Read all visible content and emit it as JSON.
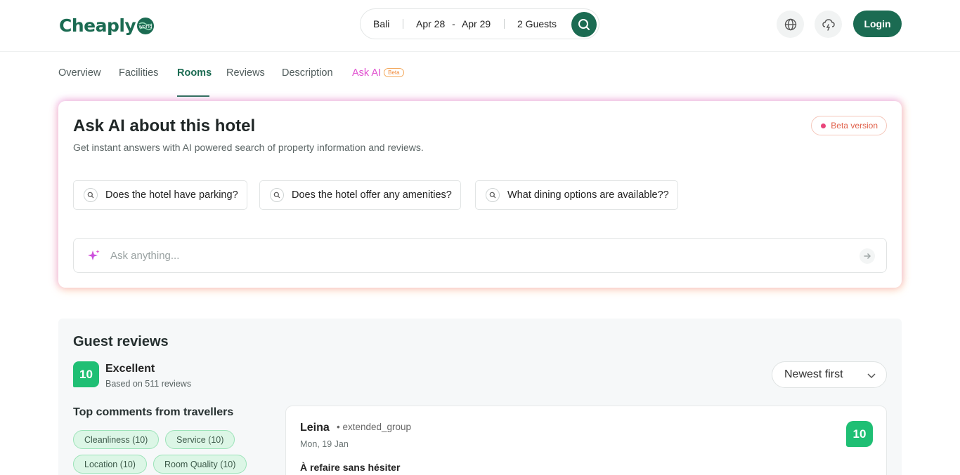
{
  "header": {
    "logo_main": "Cheaply",
    "logo_sub": "world",
    "search": {
      "location": "Bali",
      "date_from": "Apr 28",
      "date_to": "Apr 29",
      "date_sep": "-",
      "guests": "2 Guests"
    },
    "icons": [
      "globe-icon",
      "weather-icon",
      "search-icon"
    ],
    "login_label": "Login"
  },
  "tabs": [
    {
      "label": "Overview"
    },
    {
      "label": "Facilities"
    },
    {
      "label": "Rooms",
      "active": true
    },
    {
      "label": "Reviews"
    },
    {
      "label": "Description"
    },
    {
      "label": "Ask AI",
      "badge": "Beta"
    }
  ],
  "ask_ai": {
    "title": "Ask AI about this hotel",
    "subtitle": "Get instant answers with AI powered search of property information and reviews.",
    "beta_badge": "Beta version",
    "suggestions": [
      "Does the hotel have parking?",
      "Does the hotel offer any amenities?",
      "What dining options are available??"
    ],
    "input_placeholder": "Ask anything...",
    "accent_colors": [
      "#e04fcf",
      "#f08a3a"
    ]
  },
  "reviews": {
    "title": "Guest reviews",
    "score": "10",
    "score_label": "Excellent",
    "based_on": "Based on 511 reviews",
    "sort_selected": "Newest first",
    "top_comments_title": "Top comments from travellers",
    "tags": [
      "Cleanliness (10)",
      "Service (10)",
      "Location (10)",
      "Room Quality (10)"
    ],
    "items": [
      {
        "name": "Leina",
        "group": "• extended_group",
        "date": "Mon, 19 Jan",
        "score": "10",
        "headline": "À refaire sans hésiter"
      }
    ]
  },
  "colors": {
    "brand": "#1b6b52",
    "score_green": "#1fbf74",
    "tag_bg": "#dcf6e6"
  }
}
